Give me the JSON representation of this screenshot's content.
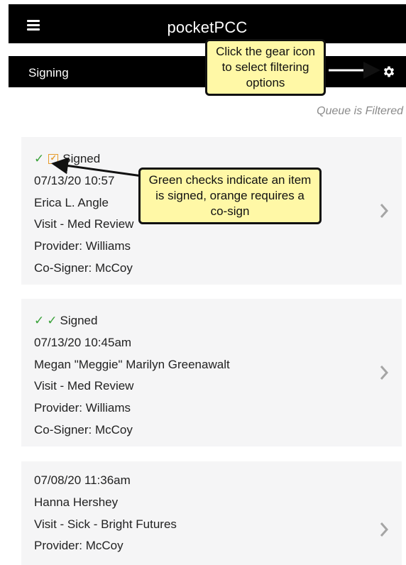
{
  "app": {
    "title": "pocketPCC"
  },
  "subheader": {
    "title": "Signing"
  },
  "queue_status": "Queue is Filtered",
  "callouts": {
    "gear": "Click the gear icon to select filtering options",
    "checks": "Green checks indicate an item is signed, orange requires a co-sign"
  },
  "queue": [
    {
      "status": "Signed",
      "datetime": "07/13/20 10:57",
      "patient": "Erica L. Angle",
      "visit": "Visit - Med Review",
      "provider": "Provider: Williams",
      "cosigner": "Co-Signer: McCoy"
    },
    {
      "status": "Signed",
      "datetime": "07/13/20 10:45am",
      "patient": "Megan \"Meggie\" Marilyn Greenawalt",
      "visit": "Visit - Med Review",
      "provider": "Provider: Williams",
      "cosigner": "Co-Signer: McCoy"
    },
    {
      "datetime": "07/08/20 11:36am",
      "patient": "Hanna Hershey",
      "visit": "Visit - Sick - Bright Futures",
      "provider": "Provider: McCoy"
    }
  ],
  "colors": {
    "signed_check": "#3aa23a",
    "cosign_check": "#e69b2b",
    "callout_bg": "#fff8a6",
    "card_bg": "#f5f5f6"
  }
}
